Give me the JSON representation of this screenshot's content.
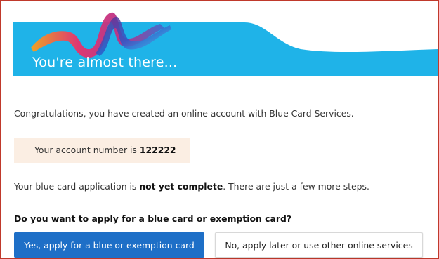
{
  "colors": {
    "banner_blue": "#1fb3e8",
    "primary_button": "#1e6fc7",
    "account_box_bg": "#fbeee3",
    "frame_border": "#c0392b"
  },
  "banner": {
    "title": "You're almost there...",
    "logo_icon": "ribbon-swirl-icon"
  },
  "content": {
    "congratulations": "Congratulations, you have created an online account with Blue Card Services.",
    "account_prefix": "Your account number is ",
    "account_number": "122222",
    "status_prefix": "Your blue card application is ",
    "status_emphasis": "not yet complete",
    "status_suffix": ". There are just a few more steps.",
    "question": "Do you want to apply for a blue card or exemption card?"
  },
  "buttons": {
    "apply_label": "Yes, apply for a blue or exemption card",
    "later_label": "No, apply later or use other online services"
  }
}
